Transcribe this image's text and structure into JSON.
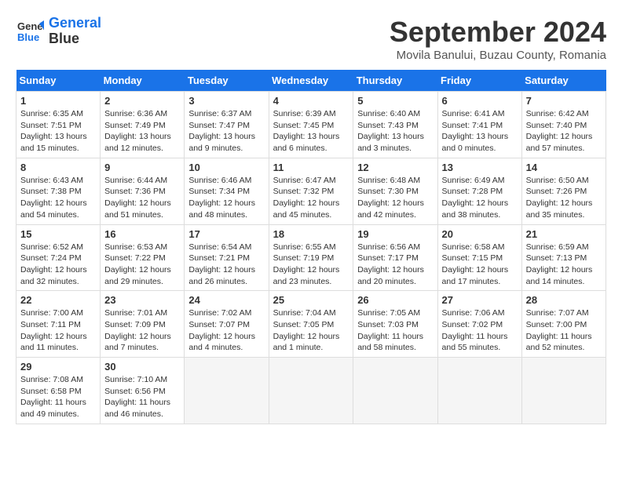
{
  "header": {
    "logo_line1": "General",
    "logo_line2": "Blue",
    "month_title": "September 2024",
    "subtitle": "Movila Banului, Buzau County, Romania"
  },
  "days_of_week": [
    "Sunday",
    "Monday",
    "Tuesday",
    "Wednesday",
    "Thursday",
    "Friday",
    "Saturday"
  ],
  "weeks": [
    [
      {
        "day": "1",
        "info": "Sunrise: 6:35 AM\nSunset: 7:51 PM\nDaylight: 13 hours\nand 15 minutes."
      },
      {
        "day": "2",
        "info": "Sunrise: 6:36 AM\nSunset: 7:49 PM\nDaylight: 13 hours\nand 12 minutes."
      },
      {
        "day": "3",
        "info": "Sunrise: 6:37 AM\nSunset: 7:47 PM\nDaylight: 13 hours\nand 9 minutes."
      },
      {
        "day": "4",
        "info": "Sunrise: 6:39 AM\nSunset: 7:45 PM\nDaylight: 13 hours\nand 6 minutes."
      },
      {
        "day": "5",
        "info": "Sunrise: 6:40 AM\nSunset: 7:43 PM\nDaylight: 13 hours\nand 3 minutes."
      },
      {
        "day": "6",
        "info": "Sunrise: 6:41 AM\nSunset: 7:41 PM\nDaylight: 13 hours\nand 0 minutes."
      },
      {
        "day": "7",
        "info": "Sunrise: 6:42 AM\nSunset: 7:40 PM\nDaylight: 12 hours\nand 57 minutes."
      }
    ],
    [
      {
        "day": "8",
        "info": "Sunrise: 6:43 AM\nSunset: 7:38 PM\nDaylight: 12 hours\nand 54 minutes."
      },
      {
        "day": "9",
        "info": "Sunrise: 6:44 AM\nSunset: 7:36 PM\nDaylight: 12 hours\nand 51 minutes."
      },
      {
        "day": "10",
        "info": "Sunrise: 6:46 AM\nSunset: 7:34 PM\nDaylight: 12 hours\nand 48 minutes."
      },
      {
        "day": "11",
        "info": "Sunrise: 6:47 AM\nSunset: 7:32 PM\nDaylight: 12 hours\nand 45 minutes."
      },
      {
        "day": "12",
        "info": "Sunrise: 6:48 AM\nSunset: 7:30 PM\nDaylight: 12 hours\nand 42 minutes."
      },
      {
        "day": "13",
        "info": "Sunrise: 6:49 AM\nSunset: 7:28 PM\nDaylight: 12 hours\nand 38 minutes."
      },
      {
        "day": "14",
        "info": "Sunrise: 6:50 AM\nSunset: 7:26 PM\nDaylight: 12 hours\nand 35 minutes."
      }
    ],
    [
      {
        "day": "15",
        "info": "Sunrise: 6:52 AM\nSunset: 7:24 PM\nDaylight: 12 hours\nand 32 minutes."
      },
      {
        "day": "16",
        "info": "Sunrise: 6:53 AM\nSunset: 7:22 PM\nDaylight: 12 hours\nand 29 minutes."
      },
      {
        "day": "17",
        "info": "Sunrise: 6:54 AM\nSunset: 7:21 PM\nDaylight: 12 hours\nand 26 minutes."
      },
      {
        "day": "18",
        "info": "Sunrise: 6:55 AM\nSunset: 7:19 PM\nDaylight: 12 hours\nand 23 minutes."
      },
      {
        "day": "19",
        "info": "Sunrise: 6:56 AM\nSunset: 7:17 PM\nDaylight: 12 hours\nand 20 minutes."
      },
      {
        "day": "20",
        "info": "Sunrise: 6:58 AM\nSunset: 7:15 PM\nDaylight: 12 hours\nand 17 minutes."
      },
      {
        "day": "21",
        "info": "Sunrise: 6:59 AM\nSunset: 7:13 PM\nDaylight: 12 hours\nand 14 minutes."
      }
    ],
    [
      {
        "day": "22",
        "info": "Sunrise: 7:00 AM\nSunset: 7:11 PM\nDaylight: 12 hours\nand 11 minutes."
      },
      {
        "day": "23",
        "info": "Sunrise: 7:01 AM\nSunset: 7:09 PM\nDaylight: 12 hours\nand 7 minutes."
      },
      {
        "day": "24",
        "info": "Sunrise: 7:02 AM\nSunset: 7:07 PM\nDaylight: 12 hours\nand 4 minutes."
      },
      {
        "day": "25",
        "info": "Sunrise: 7:04 AM\nSunset: 7:05 PM\nDaylight: 12 hours\nand 1 minute."
      },
      {
        "day": "26",
        "info": "Sunrise: 7:05 AM\nSunset: 7:03 PM\nDaylight: 11 hours\nand 58 minutes."
      },
      {
        "day": "27",
        "info": "Sunrise: 7:06 AM\nSunset: 7:02 PM\nDaylight: 11 hours\nand 55 minutes."
      },
      {
        "day": "28",
        "info": "Sunrise: 7:07 AM\nSunset: 7:00 PM\nDaylight: 11 hours\nand 52 minutes."
      }
    ],
    [
      {
        "day": "29",
        "info": "Sunrise: 7:08 AM\nSunset: 6:58 PM\nDaylight: 11 hours\nand 49 minutes."
      },
      {
        "day": "30",
        "info": "Sunrise: 7:10 AM\nSunset: 6:56 PM\nDaylight: 11 hours\nand 46 minutes."
      },
      {
        "day": "",
        "info": ""
      },
      {
        "day": "",
        "info": ""
      },
      {
        "day": "",
        "info": ""
      },
      {
        "day": "",
        "info": ""
      },
      {
        "day": "",
        "info": ""
      }
    ]
  ]
}
